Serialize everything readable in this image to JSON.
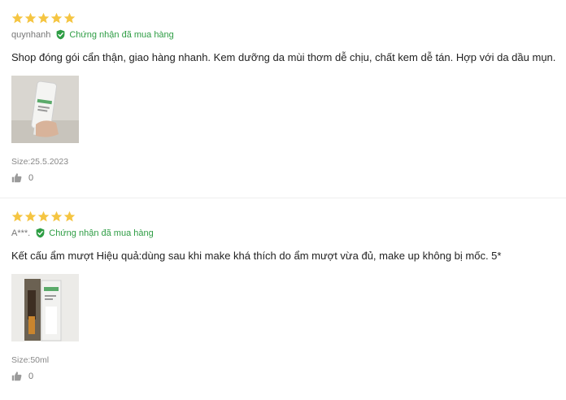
{
  "colors": {
    "star": "#f5c542",
    "verified": "#2e9d44",
    "text": "#222222",
    "muted": "#888888"
  },
  "reviews": [
    {
      "rating": 5,
      "username": "quynhanh",
      "verified_label": "Chứng nhận đã mua hàng",
      "comment": "Shop đóng gói cẩn thận, giao hàng nhanh. Kem dưỡng da mùi thơm dễ chịu, chất kem dễ tán. Hợp với da dầu mụn.",
      "size": "Size:25.5.2023",
      "likes": "0"
    },
    {
      "rating": 5,
      "username": "A***.",
      "verified_label": "Chứng nhận đã mua hàng",
      "comment": "Kết cấu ẩm mượt Hiệu quả:dùng sau khi make khá thích do ẩm mượt vừa đủ, make up không bị mốc. 5*",
      "size": "Size:50ml",
      "likes": "0"
    }
  ]
}
